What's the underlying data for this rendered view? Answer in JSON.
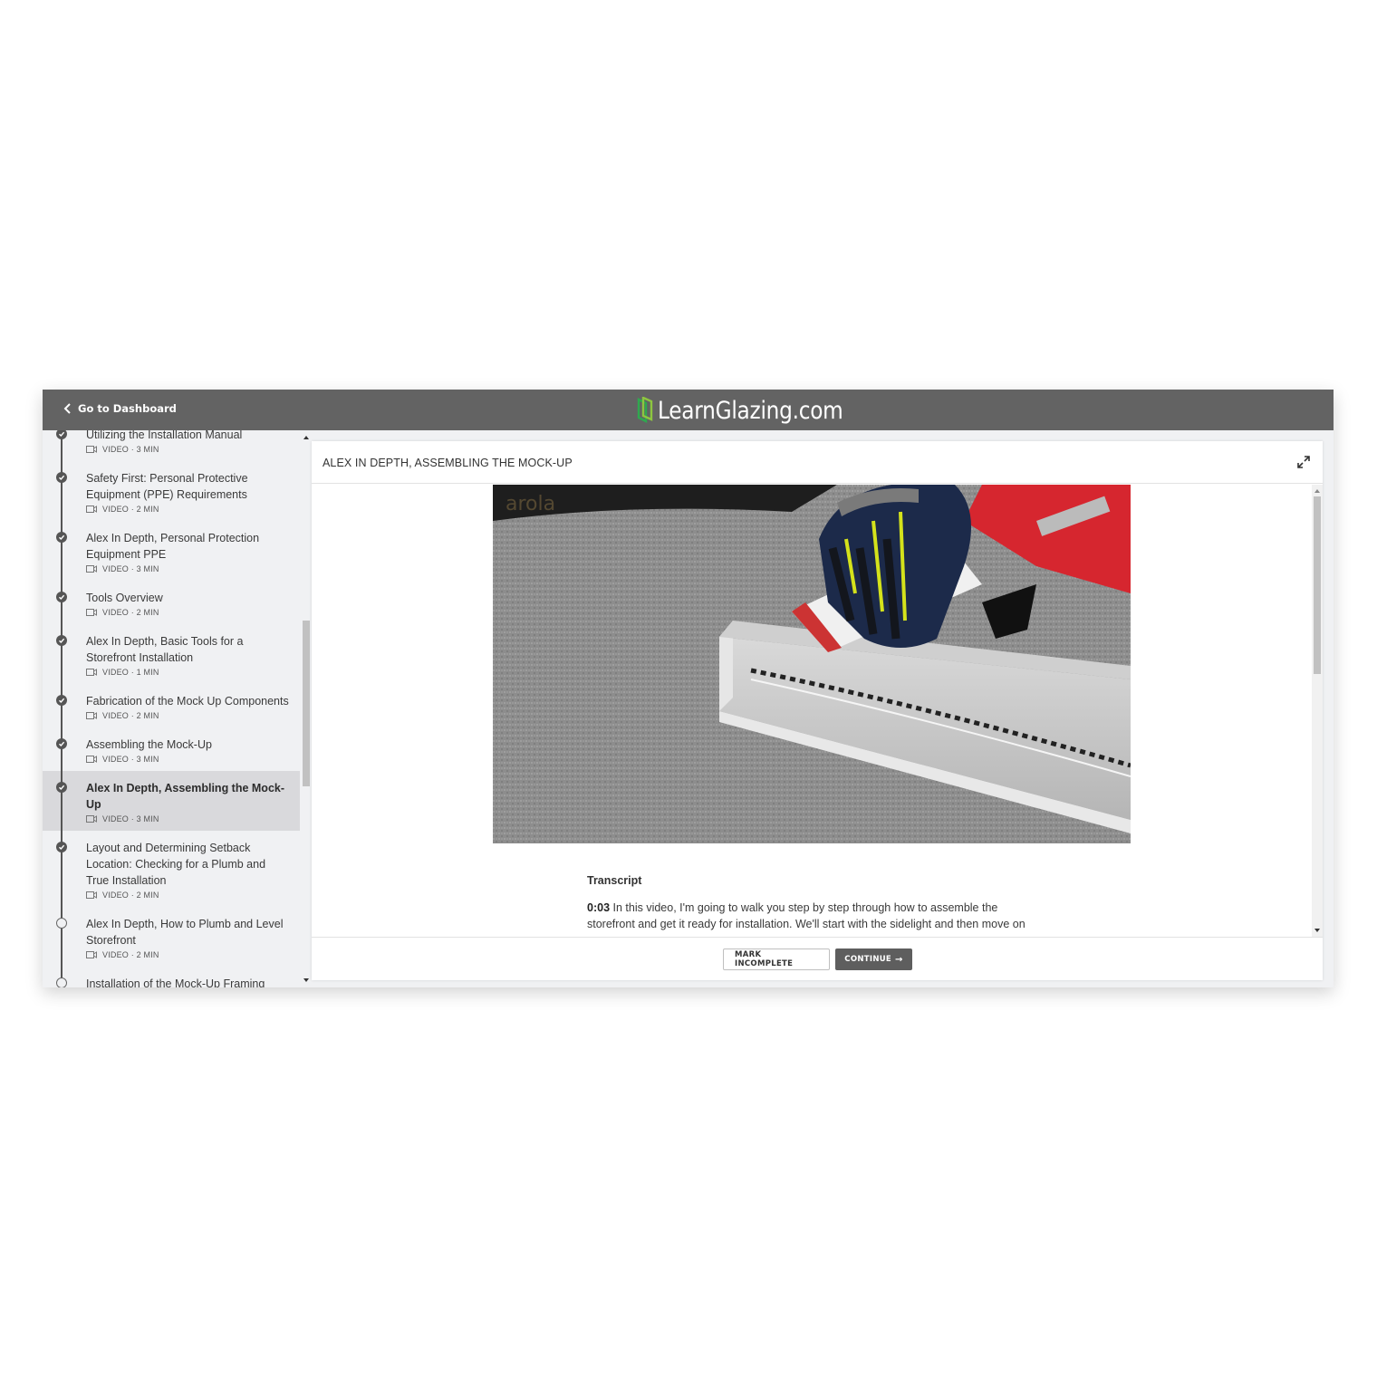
{
  "topbar": {
    "back_label": "Go to Dashboard",
    "brand": "LearnGlazing.com",
    "brand_colors": {
      "logo_green_dark": "#2fa84f",
      "logo_green_light": "#8dc63f",
      "bar_bg": "#636363"
    }
  },
  "sidebar": {
    "lessons": [
      {
        "title": "Utilizing the Installation Manual",
        "meta": "VIDEO · 3 MIN",
        "status": "complete",
        "active": false,
        "partially_visible": true
      },
      {
        "title": "Safety First: Personal Protective Equipment (PPE) Requirements",
        "meta": "VIDEO · 2 MIN",
        "status": "complete",
        "active": false
      },
      {
        "title": "Alex In Depth, Personal Protection Equipment PPE",
        "meta": "VIDEO · 3 MIN",
        "status": "complete",
        "active": false
      },
      {
        "title": "Tools Overview",
        "meta": "VIDEO · 2 MIN",
        "status": "complete",
        "active": false
      },
      {
        "title": "Alex In Depth, Basic Tools for a Storefront Installation",
        "meta": "VIDEO · 1 MIN",
        "status": "complete",
        "active": false
      },
      {
        "title": "Fabrication of the Mock Up Components",
        "meta": "VIDEO · 2 MIN",
        "status": "complete",
        "active": false
      },
      {
        "title": "Assembling the Mock-Up",
        "meta": "VIDEO · 3 MIN",
        "status": "complete",
        "active": false
      },
      {
        "title": "Alex In Depth, Assembling the Mock-Up",
        "meta": "VIDEO · 3 MIN",
        "status": "complete",
        "active": true
      },
      {
        "title": "Layout and Determining Setback Location: Checking for a Plumb and True Installation",
        "meta": "VIDEO · 2 MIN",
        "status": "complete",
        "active": false
      },
      {
        "title": "Alex In Depth, How to Plumb and Level Storefront",
        "meta": "VIDEO · 2 MIN",
        "status": "incomplete",
        "active": false
      },
      {
        "title": "Installation of the Mock-Up Framing",
        "meta": "",
        "status": "incomplete",
        "active": false,
        "partially_visible": true
      }
    ]
  },
  "main": {
    "lesson_title": "ALEX IN DEPTH, ASSEMBLING THE MOCK-UP",
    "video": {
      "description": "Gloved hand applying sealant with a red caulking gun into an aluminum storefront sill on gray carpet"
    },
    "transcript": {
      "heading": "Transcript",
      "entries": [
        {
          "time": "0:03",
          "text": " In this video, I'm going to walk you step by step through how to assemble the storefront and get it ready for installation. We'll start with the sidelight and then move on"
        }
      ]
    },
    "footer": {
      "mark_incomplete_label": "MARK INCOMPLETE",
      "continue_label": "CONTINUE",
      "continue_arrow": "→"
    }
  }
}
